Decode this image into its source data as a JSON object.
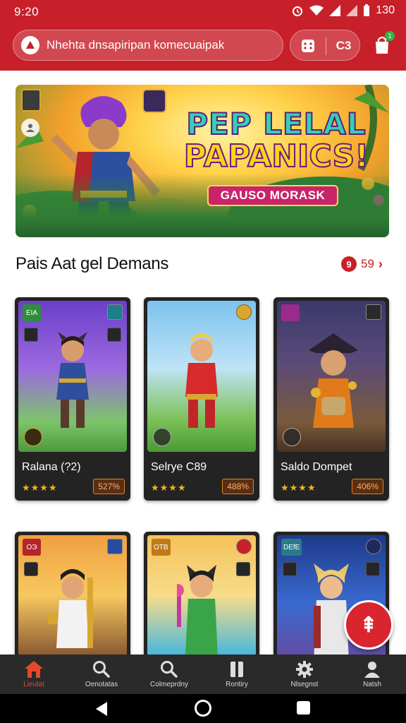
{
  "status": {
    "time": "9:20",
    "battery": "130"
  },
  "search": {
    "placeholder": "Nhehta dnsapiripan komecuaipak"
  },
  "header": {
    "pill_right_label": "C3",
    "bag_badge": "1"
  },
  "banner": {
    "title_line1": "PEP LELAL",
    "title_line2": "PAPANICS!",
    "subtitle": "GAUSO MORASK"
  },
  "section": {
    "title": "Pais Aat gel Demans",
    "see_all_badge": "9",
    "see_all_count": "59"
  },
  "cards": [
    {
      "name": "Ralana (?2)",
      "price": "527%",
      "rating": "★★★★",
      "tag": "EIA",
      "theme": "purple"
    },
    {
      "name": "Selrye C89",
      "price": "488%",
      "rating": "★★★★",
      "tag": "",
      "theme": "sky"
    },
    {
      "name": "Saldo Dompet",
      "price": "406%",
      "rating": "★★★★",
      "tag": "",
      "theme": "dark"
    },
    {
      "name": "",
      "price": "",
      "rating": "",
      "tag": "OЭ",
      "theme": "orange"
    },
    {
      "name": "",
      "price": "",
      "rating": "",
      "tag": "OTB",
      "theme": "beach"
    },
    {
      "name": "",
      "price": "",
      "rating": "",
      "tag": "DEfE",
      "theme": "blue"
    }
  ],
  "fab": {
    "label": "⇞"
  },
  "nav": [
    {
      "label": "Lieulat",
      "icon": "home-icon"
    },
    {
      "label": "Oenotatas",
      "icon": "search-icon"
    },
    {
      "label": "Colmeprdny",
      "icon": "search-icon"
    },
    {
      "label": "Rontiry",
      "icon": "book-icon"
    },
    {
      "label": "Nlsegnst",
      "icon": "gear-icon"
    },
    {
      "label": "Natsh",
      "icon": "user-icon"
    }
  ],
  "colors": {
    "primary": "#c8202a",
    "nav_bg": "#2a2a2a",
    "active": "#e44a2a",
    "star": "#f4b41a"
  }
}
